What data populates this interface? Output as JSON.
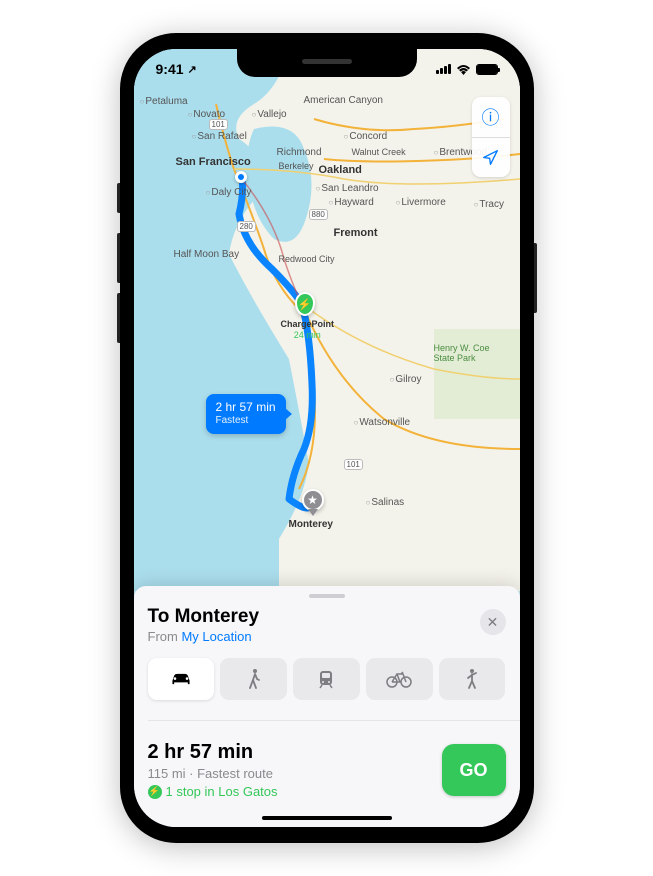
{
  "status": {
    "time": "9:41",
    "loc_arrow": "↗"
  },
  "map": {
    "controls": {
      "info": "ⓘ",
      "locate": "➤"
    },
    "cities_bold": {
      "sf": "San Francisco",
      "oakland": "Oakland",
      "fremont": "Fremont",
      "monterey": "Monterey"
    },
    "cities": {
      "petaluma": "Petaluma",
      "novato": "Novato",
      "vallejo": "Vallejo",
      "american_canyon": "American Canyon",
      "san_rafael": "San Rafael",
      "concord": "Concord",
      "richmond": "Richmond",
      "walnut_creek": "Walnut Creek",
      "brentwood": "Brentwood",
      "berkeley": "Berkeley",
      "san_leandro": "San Leandro",
      "daly_city": "Daly City",
      "hayward": "Hayward",
      "livermore": "Livermore",
      "tracy": "Tracy",
      "hmb": "Half Moon Bay",
      "redwood": "Redwood City",
      "gilroy": "Gilroy",
      "watsonville": "Watsonville",
      "salinas": "Salinas"
    },
    "park": "Henry W. Coe State Park",
    "shields": {
      "s101a": "101",
      "s280": "280",
      "s880": "880",
      "s101b": "101"
    }
  },
  "route_callout": {
    "time": "2 hr 57 min",
    "sub": "Fastest"
  },
  "charge_stop": {
    "name": "ChargePoint",
    "duration": "24 min"
  },
  "destination_label": "Monterey",
  "sheet": {
    "title": "To Monterey",
    "from_prefix": "From ",
    "from_link": "My Location",
    "modes": {
      "drive": "car-icon",
      "walk": "walk-icon",
      "transit": "transit-icon",
      "bike": "bike-icon",
      "rideshare": "rideshare-icon"
    },
    "route": {
      "time": "2 hr 57 min",
      "distance": "115 mi · Fastest route",
      "stop": "1 stop in Los Gatos"
    },
    "go_label": "GO"
  }
}
